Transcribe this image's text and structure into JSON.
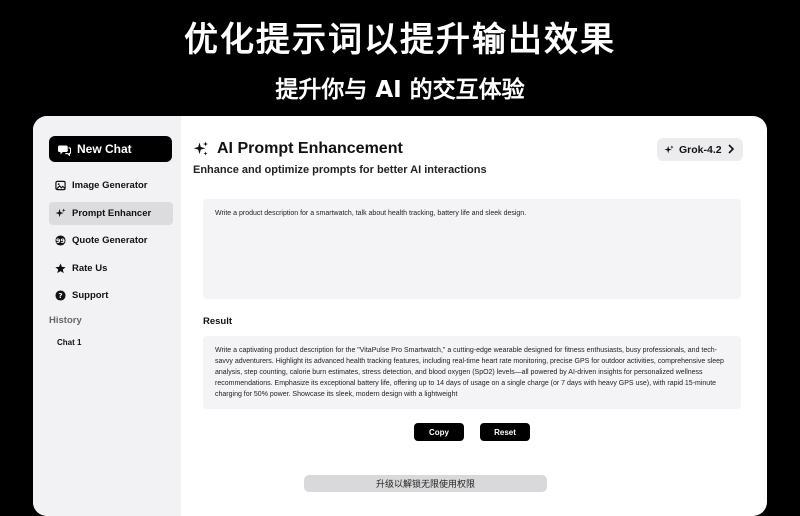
{
  "promo": {
    "title": "优化提示词以提升输出效果",
    "subtitle": "提升你与 AI 的交互体验"
  },
  "sidebar": {
    "new_chat_label": "New Chat",
    "items": [
      {
        "label": "Image Generator",
        "icon": "image-icon"
      },
      {
        "label": "Prompt Enhancer",
        "icon": "sparkles-icon",
        "active": true
      },
      {
        "label": "Quote Generator",
        "icon": "quote-icon"
      },
      {
        "label": "Rate Us",
        "icon": "star-icon"
      },
      {
        "label": "Support",
        "icon": "help-icon"
      }
    ],
    "history_label": "History",
    "history": [
      "Chat 1"
    ]
  },
  "main": {
    "title": "AI Prompt Enhancement",
    "subtitle": "Enhance and optimize prompts for better AI interactions",
    "model": "Grok-4.2",
    "prompt_text": "Write a product description for a smartwatch, talk about health tracking, battery life and sleek design.",
    "result_label": "Result",
    "result_text": "Write a captivating product description for the \"VitaPulse Pro Smartwatch,\" a cutting-edge wearable designed for fitness enthusiasts, busy professionals, and tech-savvy adventurers. Highlight its advanced health tracking features, including real-time heart rate monitoring, precise GPS for outdoor activities, comprehensive sleep analysis, step counting, calorie burn estimates, stress detection, and blood oxygen (SpO2) levels—all powered by AI-driven insights for personalized wellness recommendations. Emphasize its exceptional battery life, offering up to 14 days of usage on a single charge (or 7 days with heavy GPS use), with rapid 15-minute charging for 50% power. Showcase its sleek, modern design with a lightweight",
    "copy_label": "Copy",
    "reset_label": "Reset",
    "upgrade_label": "升级以解锁无限使用权限"
  },
  "colors": {
    "background": "#000000",
    "sidebar": "#f2f2f4",
    "accent": "#000000"
  }
}
